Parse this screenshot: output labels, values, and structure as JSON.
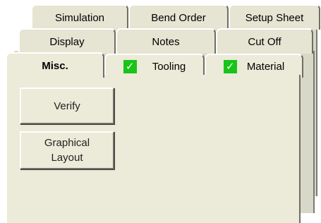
{
  "tabs": {
    "row_back": [
      "Simulation",
      "Bend Order",
      "Setup Sheet"
    ],
    "row_middle": [
      "Display",
      "Notes",
      "Cut Off"
    ],
    "row_front": {
      "active": "Misc.",
      "tooling": "Tooling",
      "material": "Material"
    }
  },
  "icons": {
    "tooling_status": "green-check-icon",
    "material_status": "green-check-icon"
  },
  "colors": {
    "check_green": "#18c418",
    "panel_bg": "#ecead8"
  },
  "buttons": {
    "verify": "Verify",
    "graphical_layout_line1": "Graphical",
    "graphical_layout_line2": "Layout"
  }
}
